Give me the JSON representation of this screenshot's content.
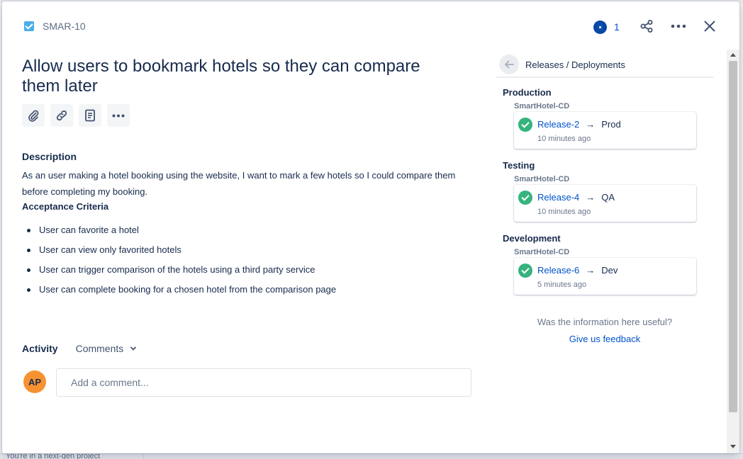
{
  "issue": {
    "key": "SMAR-10",
    "title": "Allow users to bookmark hotels so they can compare them later",
    "watchers": "1"
  },
  "icons": {
    "issue_type": "checkbox-icon",
    "watch": "eye-icon",
    "share": "share-icon",
    "more": "more-icon",
    "close": "close-icon",
    "attach": "paperclip-icon",
    "link": "link-icon",
    "page": "document-icon",
    "toolbar_more": "ellipsis-icon",
    "back": "arrow-left-icon",
    "deploy_status": "check-circle-icon"
  },
  "description": {
    "label": "Description",
    "text": "As an user making a hotel booking using the website, I want to mark a few hotels so I could compare them before completing my booking.",
    "criteria_label": "Acceptance Criteria",
    "criteria": [
      "User can favorite a hotel",
      "User can view only favorited hotels",
      "User can trigger comparison of the hotels using a third party service",
      "User can complete booking for a chosen hotel from the comparison page"
    ]
  },
  "activity": {
    "label": "Activity",
    "filter": "Comments",
    "avatar": "AP",
    "placeholder": "Add a comment..."
  },
  "panel": {
    "title": "Releases / Deployments",
    "environments": [
      {
        "name": "Production",
        "pipeline": "SmartHotel-CD",
        "release": "Release-2",
        "arrow": "→",
        "target": "Prod",
        "time": "10 minutes ago"
      },
      {
        "name": "Testing",
        "pipeline": "SmartHotel-CD",
        "release": "Release-4",
        "arrow": "→",
        "target": "QA",
        "time": "10 minutes ago"
      },
      {
        "name": "Development",
        "pipeline": "SmartHotel-CD",
        "release": "Release-6",
        "arrow": "→",
        "target": "Dev",
        "time": "5 minutes ago"
      }
    ],
    "feedback_question": "Was the information here useful?",
    "feedback_link": "Give us feedback"
  },
  "background": {
    "footer_text": "You're in a next-gen project"
  },
  "colors": {
    "link": "#0052cc",
    "text": "#172b4d",
    "success": "#36b37e",
    "avatar": "#f79232",
    "watch": "#0747a6"
  }
}
